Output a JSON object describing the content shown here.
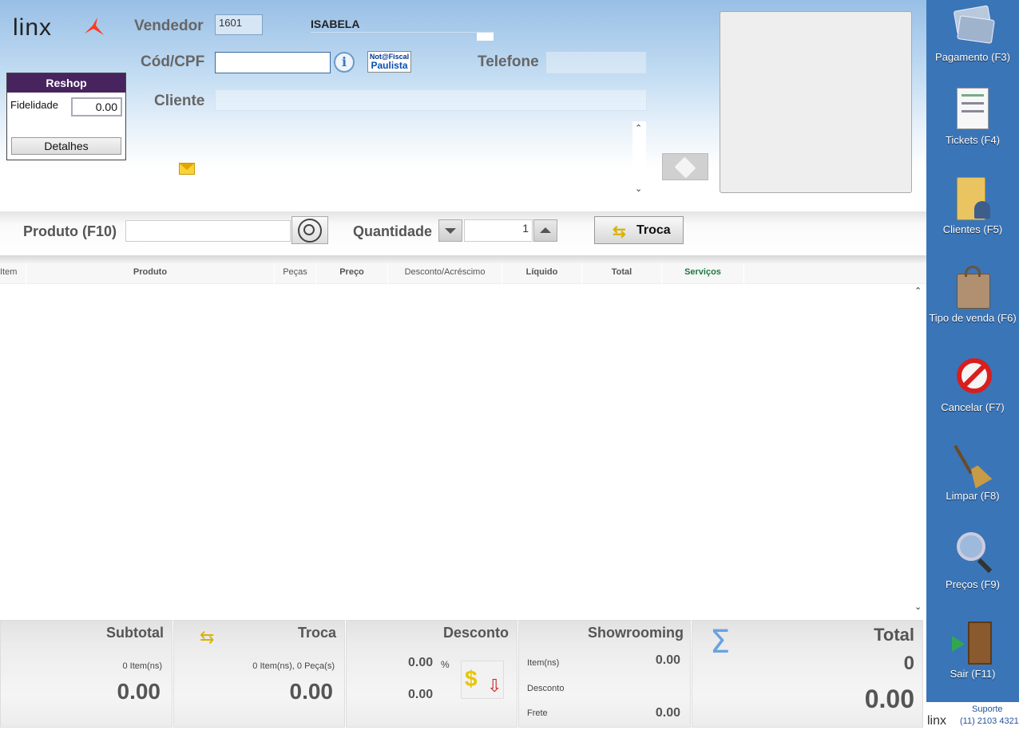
{
  "brand": {
    "logo_text": "linx",
    "accent": "#ff3b1f"
  },
  "header": {
    "vendedor_label": "Vendedor",
    "vendedor_code": "1601",
    "vendedor_name": "ISABELA",
    "cpf_label": "Cód/CPF",
    "cpf_value": "",
    "nota_fiscal_line1": "Not@Fiscal",
    "nota_fiscal_line2": "Paulista",
    "telefone_label": "Telefone",
    "telefone_value": "",
    "cliente_label": "Cliente",
    "cliente_value": ""
  },
  "reshop": {
    "title": "Reshop",
    "fidelidade_label": "Fidelidade",
    "fidelidade_value": "0.00",
    "detalhes_label": "Detalhes"
  },
  "product_bar": {
    "produto_label": "Produto (F10)",
    "produto_value": "",
    "quantidade_label": "Quantidade",
    "quantidade_value": "1",
    "troca_label": "Troca"
  },
  "grid": {
    "columns": [
      "Item",
      "Produto",
      "Peças",
      "Preço",
      "Desconto/Acréscimo",
      "Líquido",
      "Total",
      "Serviços"
    ],
    "rows": []
  },
  "totals": {
    "subtotal": {
      "title": "Subtotal",
      "items": "0 Item(ns)",
      "value": "0.00"
    },
    "troca": {
      "title": "Troca",
      "items": "0 Item(ns), 0 Peça(s)",
      "value": "0.00"
    },
    "desconto": {
      "title": "Desconto",
      "percent": "0.00",
      "percent_sign": "%",
      "value": "0.00"
    },
    "showrooming": {
      "title": "Showrooming",
      "items_label": "Item(ns)",
      "items_value": "0.00",
      "desconto_label": "Desconto",
      "frete_label": "Frete",
      "frete_value": "0.00"
    },
    "total": {
      "title": "Total",
      "count": "0",
      "value": "0.00"
    }
  },
  "sidebar": {
    "bg_color": "#3a75b8",
    "items": [
      {
        "label": "Pagamento (F3)",
        "icon": "payment-cards-icon"
      },
      {
        "label": "Tickets (F4)",
        "icon": "tickets-icon"
      },
      {
        "label": "Clientes (F5)",
        "icon": "clients-folder-icon"
      },
      {
        "label": "Tipo de venda (F6)",
        "icon": "shopping-bag-icon"
      },
      {
        "label": "Cancelar (F7)",
        "icon": "cancel-icon"
      },
      {
        "label": "Limpar (F8)",
        "icon": "broom-icon"
      },
      {
        "label": "Preços (F9)",
        "icon": "price-magnifier-icon"
      },
      {
        "label": "Sair (F11)",
        "icon": "exit-door-icon"
      }
    ]
  },
  "support": {
    "label": "Suporte",
    "phone": "(11) 2103 4321",
    "logo_text": "linx"
  }
}
